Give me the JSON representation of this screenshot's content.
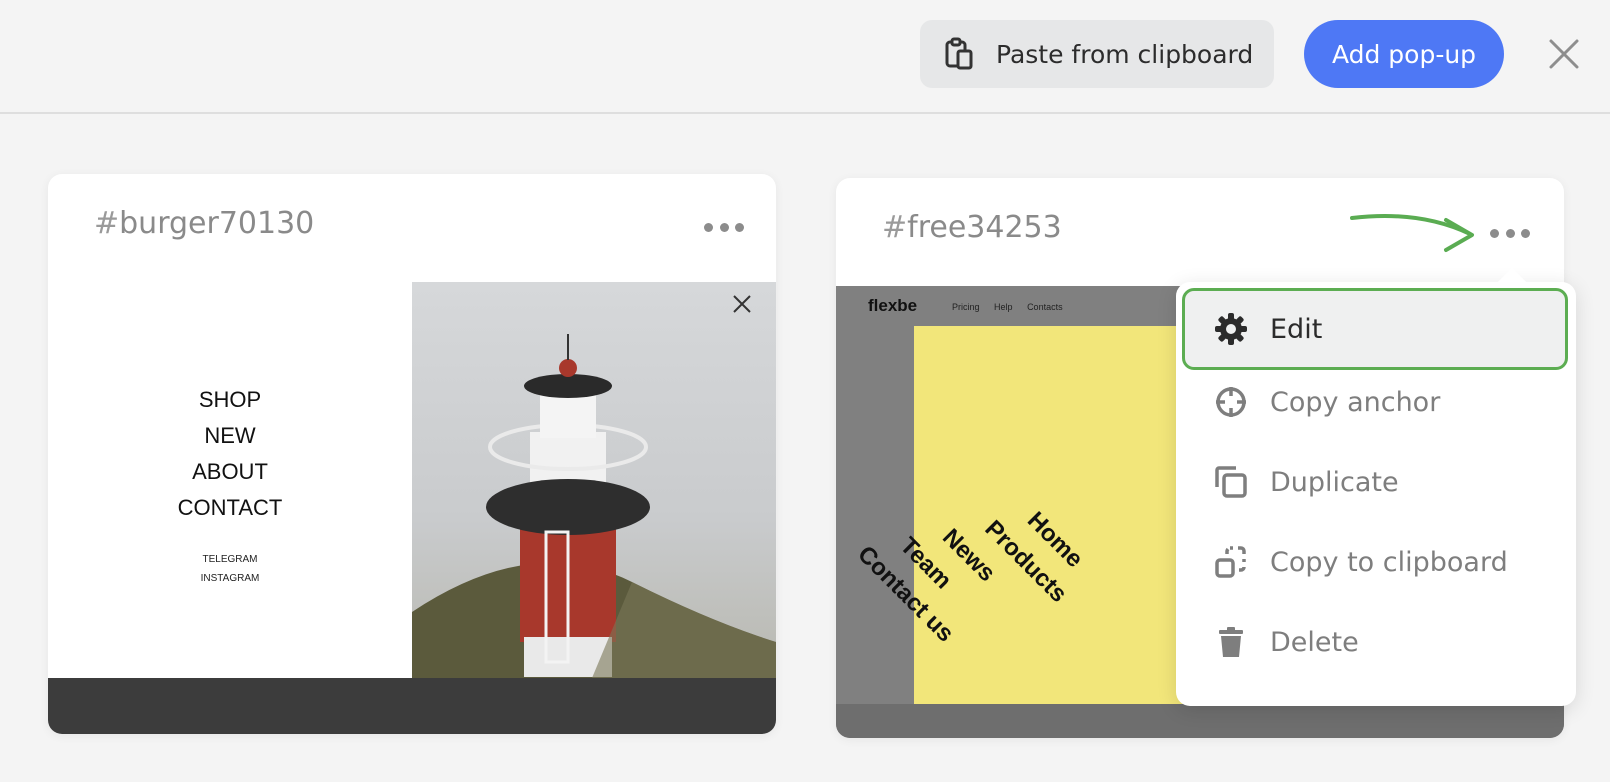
{
  "toolbar": {
    "paste_label": "Paste from clipboard",
    "add_label": "Add pop-up",
    "accent": "#4e78f5"
  },
  "cards": [
    {
      "hash": "#",
      "anchor": "burger70130",
      "preview": {
        "menu": [
          "SHOP",
          "NEW",
          "ABOUT",
          "CONTACT"
        ],
        "social": [
          "TELEGRAM",
          "INSTAGRAM"
        ]
      }
    },
    {
      "hash": "#",
      "anchor": "free34253",
      "preview": {
        "brand": "flexbe",
        "nav": [
          "Pricing",
          "Help",
          "Contacts"
        ],
        "links": [
          "Home",
          "Products",
          "News",
          "Team",
          "Contact us"
        ]
      }
    }
  ],
  "context_menu": {
    "items": [
      {
        "label": "Edit",
        "icon": "gear-icon"
      },
      {
        "label": "Copy anchor",
        "icon": "crosshair-icon"
      },
      {
        "label": "Duplicate",
        "icon": "duplicate-icon"
      },
      {
        "label": "Copy to clipboard",
        "icon": "copy-clipboard-icon"
      },
      {
        "label": "Delete",
        "icon": "trash-icon"
      }
    ],
    "highlight": "#5cad52"
  }
}
